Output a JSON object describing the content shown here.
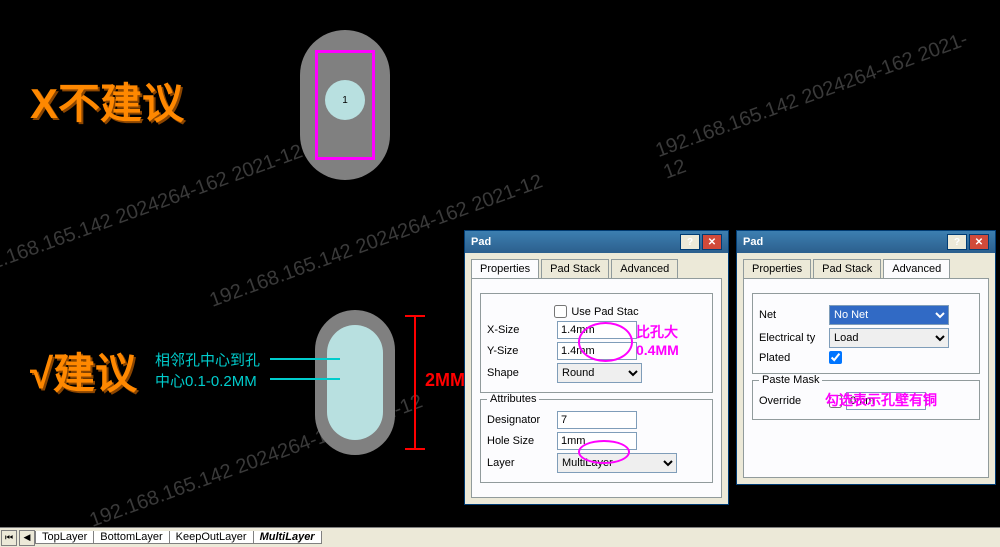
{
  "labels": {
    "not_recommend": "X不建议",
    "recommend": "√建议",
    "hint1_line1": "相邻孔中心到孔",
    "hint1_line2": "中心0.1-0.2MM",
    "dim_2mm": "2MM",
    "pad1_num": "1"
  },
  "dialog1": {
    "title": "Pad",
    "tabs": [
      "Properties",
      "Pad Stack",
      "Advanced"
    ],
    "active_tab": 0,
    "use_pad_stack": "Use Pad Stac",
    "x_size_label": "X-Size",
    "x_size": "1.4mm",
    "y_size_label": "Y-Size",
    "y_size": "1.4mm",
    "shape_label": "Shape",
    "shape": "Round",
    "attributes_title": "Attributes",
    "designator_label": "Designator",
    "designator": "7",
    "hole_size_label": "Hole Size",
    "hole_size": "1mm",
    "layer_label": "Layer",
    "layer": "MultiLayer"
  },
  "dialog2": {
    "title": "Pad",
    "tabs": [
      "Properties",
      "Pad Stack",
      "Advanced"
    ],
    "active_tab": 2,
    "net_label": "Net",
    "net": "No Net",
    "electrical_label": "Electrical ty",
    "electrical": "Load",
    "plated_label": "Plated",
    "plated": true,
    "paste_mask_title": "Paste Mask",
    "override_label": "Override",
    "override": false,
    "override_val": "0mm"
  },
  "annotations": {
    "bigger_than_hole1": "比孔大",
    "bigger_than_hole2": "0.4MM",
    "plated_hint": "勾选表示孔壁有铜"
  },
  "bottom_tabs": [
    "TopLayer",
    "BottomLayer",
    "KeepOutLayer",
    "MultiLayer"
  ],
  "bottom_selected": 3,
  "watermark": "192.168.165.142 2024264-162 2021-12"
}
